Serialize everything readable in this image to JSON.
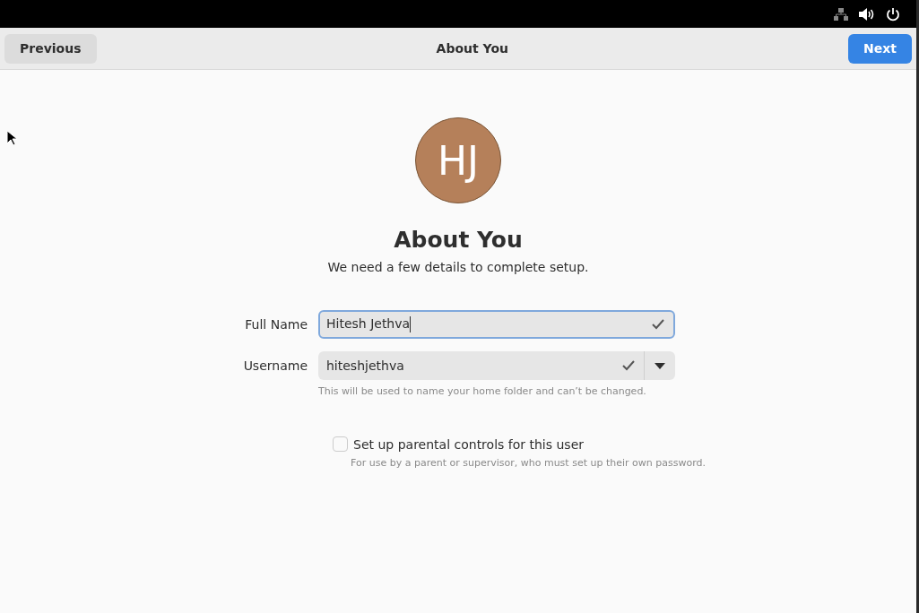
{
  "header": {
    "previous_button": "Previous",
    "title": "About You",
    "next_button": "Next"
  },
  "avatar": {
    "initials": "HJ",
    "color": "#b5805a"
  },
  "heading": "About You",
  "subtitle": "We need a few details to complete setup.",
  "fields": [
    {
      "kind": "entry",
      "label": "Full Name",
      "value": "Hitesh Jethva",
      "focused": true
    },
    {
      "kind": "combo",
      "label": "Username",
      "value": "hiteshjethva",
      "focused": false,
      "hint": "This will be used to name your home folder and can’t be changed."
    }
  ],
  "parental_controls": {
    "label": "Set up parental controls for this user",
    "checked": false,
    "description": "For use by a parent or supervisor, who must set up their own password."
  }
}
